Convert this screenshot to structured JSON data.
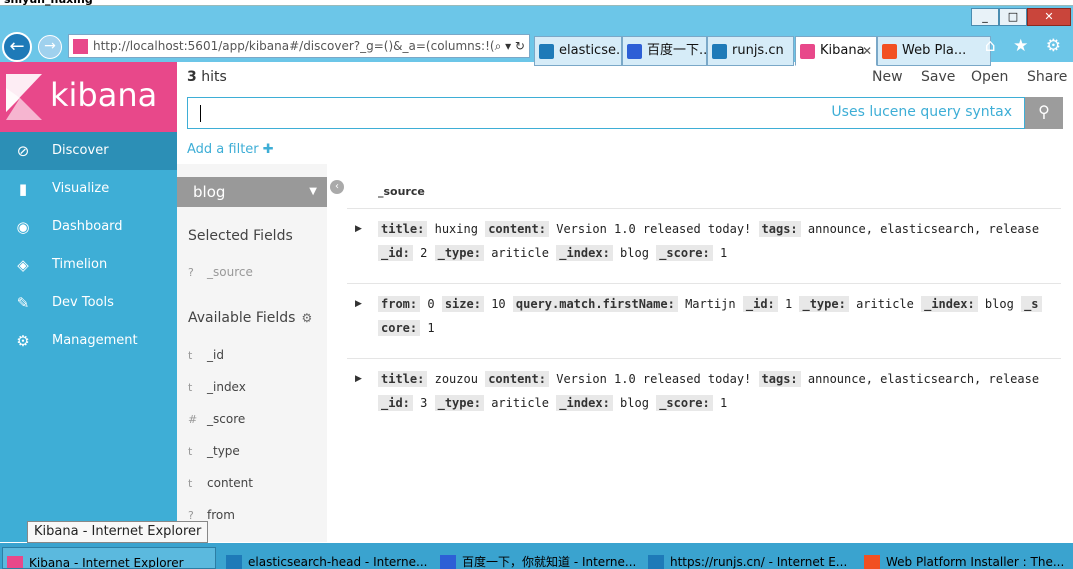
{
  "window": {
    "title_strip": "shiyun_huxing",
    "controls": [
      "_",
      "□",
      "✕"
    ]
  },
  "browser": {
    "url": "http://localhost:5601/app/kibana#/discover?_g=()&_a=(columns:!(",
    "url_controls": "⌕ ▾ ↻",
    "tabs": [
      {
        "label": "elasticse...",
        "icon_color": "#1e7ab8",
        "icon": "ie-icon"
      },
      {
        "label": "百度一下...",
        "icon_color": "#2d5fd6",
        "icon": "baidu-icon"
      },
      {
        "label": "runjs.cn",
        "icon_color": "#1e7ab8",
        "icon": "ie-icon"
      },
      {
        "label": "Kibana",
        "icon_color": "#e8488a",
        "icon": "kibana-icon",
        "active": true
      },
      {
        "label": "Web Pla...",
        "icon_color": "#f25022",
        "icon": "windows-icon"
      }
    ],
    "toolbar_icons": "⌂ ★ ⚙"
  },
  "sidebar": {
    "brand": "kibana",
    "items": [
      {
        "label": "Discover",
        "icon": "compass-icon",
        "glyph": "⊘"
      },
      {
        "label": "Visualize",
        "icon": "bar-chart-icon",
        "glyph": "▮"
      },
      {
        "label": "Dashboard",
        "icon": "dashboard-icon",
        "glyph": "◉"
      },
      {
        "label": "Timelion",
        "icon": "timelion-icon",
        "glyph": "◈"
      },
      {
        "label": "Dev Tools",
        "icon": "wrench-icon",
        "glyph": "✎"
      },
      {
        "label": "Management",
        "icon": "gear-icon",
        "glyph": "⚙"
      }
    ]
  },
  "header": {
    "hits_count": "3",
    "hits_label": "hits",
    "menu": [
      "New",
      "Save",
      "Open",
      "Share"
    ]
  },
  "search": {
    "hint": "Uses lucene query syntax",
    "button_glyph": "⚲"
  },
  "filter": {
    "add_label": "Add a filter",
    "add_glyph": "✚"
  },
  "fields_panel": {
    "index": "blog",
    "selected_title": "Selected Fields",
    "selected": [
      {
        "type": "?",
        "name": "_source"
      }
    ],
    "available_title": "Available Fields",
    "available": [
      {
        "type": "t",
        "name": "_id"
      },
      {
        "type": "t",
        "name": "_index"
      },
      {
        "type": "#",
        "name": "_score"
      },
      {
        "type": "t",
        "name": "_type"
      },
      {
        "type": "t",
        "name": "content"
      },
      {
        "type": "?",
        "name": "from"
      }
    ]
  },
  "documents": {
    "column": "_source",
    "rows": [
      {
        "line1": [
          {
            "k": "title:",
            "v": "huxing"
          },
          {
            "k": "content:",
            "v": "Version 1.0 released today!"
          },
          {
            "k": "tags:",
            "v": "announce, elasticsearch, release"
          }
        ],
        "line2": [
          {
            "k": "_id:",
            "v": "2"
          },
          {
            "k": "_type:",
            "v": "ariticle"
          },
          {
            "k": "_index:",
            "v": "blog"
          },
          {
            "k": "_score:",
            "v": "1"
          }
        ]
      },
      {
        "line1": [
          {
            "k": "from:",
            "v": "0"
          },
          {
            "k": "size:",
            "v": "10"
          },
          {
            "k": "query.match.firstName:",
            "v": "Martijn"
          },
          {
            "k": "_id:",
            "v": "1"
          },
          {
            "k": "_type:",
            "v": "ariticle"
          },
          {
            "k": "_index:",
            "v": "blog"
          },
          {
            "k": "_s",
            "v": ""
          }
        ],
        "line2": [
          {
            "k": "core:",
            "v": "1"
          }
        ]
      },
      {
        "line1": [
          {
            "k": "title:",
            "v": "zouzou"
          },
          {
            "k": "content:",
            "v": "Version 1.0 released today!"
          },
          {
            "k": "tags:",
            "v": "announce, elasticsearch, release"
          }
        ],
        "line2": [
          {
            "k": "_id:",
            "v": "3"
          },
          {
            "k": "_type:",
            "v": "ariticle"
          },
          {
            "k": "_index:",
            "v": "blog"
          },
          {
            "k": "_score:",
            "v": "1"
          }
        ]
      }
    ]
  },
  "tooltip": "Kibana - Internet Explorer",
  "taskbar": [
    {
      "label": "Kibana - Internet Explorer",
      "icon_color": "#e8488a",
      "active": true
    },
    {
      "label": "elasticsearch-head - Interne...",
      "icon_color": "#1e7ab8"
    },
    {
      "label": "百度一下，你就知道 - Interne...",
      "icon_color": "#2d5fd6"
    },
    {
      "label": "https://runjs.cn/ - Internet E...",
      "icon_color": "#1e7ab8"
    },
    {
      "label": "Web Platform Installer : The...",
      "icon_color": "#f25022"
    }
  ]
}
